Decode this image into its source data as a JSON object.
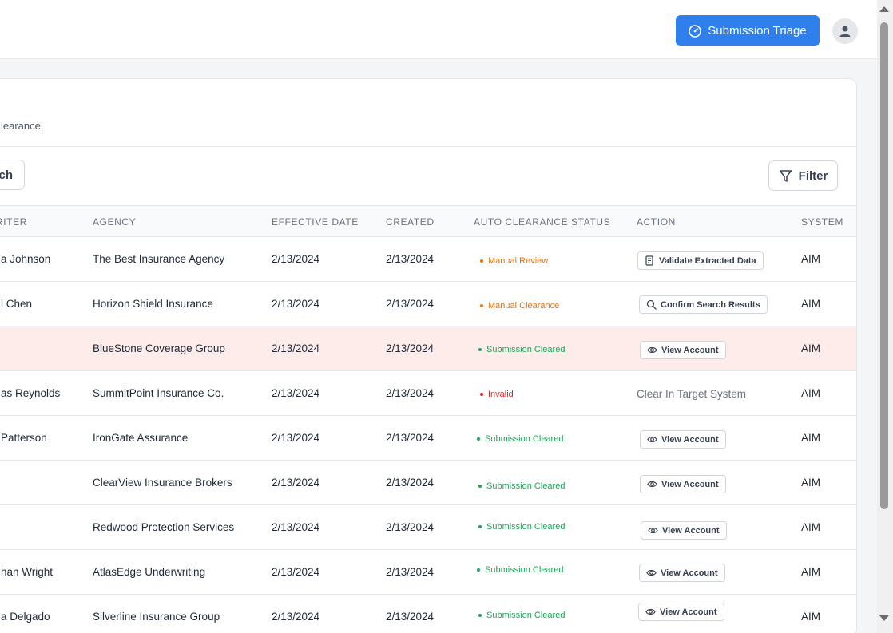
{
  "header": {
    "triage_button_label": "Submission Triage"
  },
  "card": {
    "subtitle": "learance.",
    "search_label": "ch",
    "filter_label": "Filter"
  },
  "table": {
    "columns": {
      "underwriter": "RWRITER",
      "agency": "AGENCY",
      "effective_date": "EFFECTIVE DATE",
      "created": "CREATED",
      "status": "AUTO CLEARANCE STATUS",
      "action": "ACTION",
      "system": "SYSTEM"
    },
    "rows": [
      {
        "underwriter": "a Johnson",
        "agency": "The Best Insurance Agency",
        "effective": "2/13/2024",
        "created": "2/13/2024",
        "status": "Manual Review",
        "action": "Validate Extracted Data",
        "system": "AIM"
      },
      {
        "underwriter": "l Chen",
        "agency": "Horizon Shield Insurance",
        "effective": "2/13/2024",
        "created": "2/13/2024",
        "status": "Manual Clearance",
        "action": "Confirm Search Results",
        "system": "AIM"
      },
      {
        "underwriter": "",
        "agency": "BlueStone Coverage Group",
        "effective": "2/13/2024",
        "created": "2/13/2024",
        "status": "Submission Cleared",
        "action": "View Account",
        "system": "AIM"
      },
      {
        "underwriter": "as Reynolds",
        "agency": "SummitPoint Insurance Co.",
        "effective": "2/13/2024",
        "created": "2/13/2024",
        "status": "Invalid",
        "action": "Clear In Target System",
        "system": "AIM"
      },
      {
        "underwriter": "Patterson",
        "agency": "IronGate Assurance",
        "effective": "2/13/2024",
        "created": "2/13/2024",
        "status": "Submission Cleared",
        "action": "View Account",
        "system": "AIM"
      },
      {
        "underwriter": "",
        "agency": "ClearView Insurance Brokers",
        "effective": "2/13/2024",
        "created": "2/13/2024",
        "status": "Submission Cleared",
        "action": "View Account",
        "system": "AIM"
      },
      {
        "underwriter": "",
        "agency": "Redwood Protection Services",
        "effective": "2/13/2024",
        "created": "2/13/2024",
        "status": "Submission Cleared",
        "action": "View Account",
        "system": "AIM"
      },
      {
        "underwriter": "han Wright",
        "agency": "AtlasEdge Underwriting",
        "effective": "2/13/2024",
        "created": "2/13/2024",
        "status": "Submission Cleared",
        "action": "View Account",
        "system": "AIM"
      },
      {
        "underwriter": "a Delgado",
        "agency": "Silverline Insurance Group",
        "effective": "2/13/2024",
        "created": "2/13/2024",
        "status": "Submission Cleared",
        "action": "View Account",
        "system": "AIM"
      }
    ]
  },
  "colors": {
    "primary": "#2f80ed",
    "status_review": "#e8710a",
    "status_cleared": "#22a35a",
    "status_invalid": "#dc2626",
    "row_highlight": "#fdecea"
  }
}
